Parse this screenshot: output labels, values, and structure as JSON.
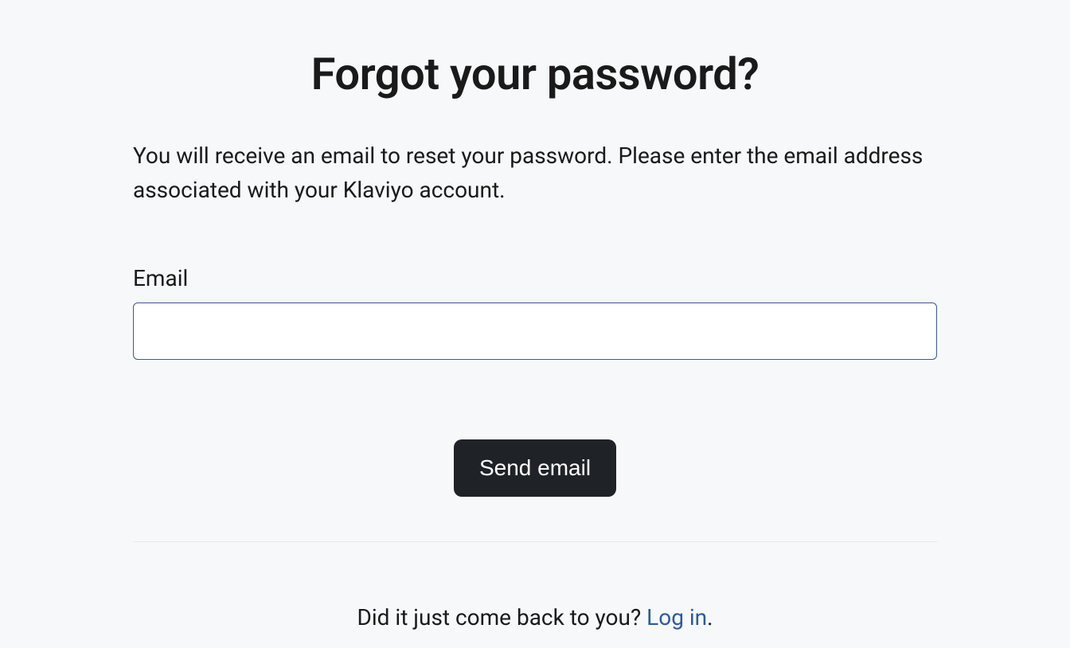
{
  "page": {
    "title": "Forgot your password?",
    "description": "You will receive an email to reset your password. Please enter the email address associated with your Klaviyo account."
  },
  "form": {
    "email_label": "Email",
    "email_value": "",
    "submit_label": "Send email"
  },
  "footer": {
    "prompt": "Did it just come back to you? ",
    "login_link_text": "Log in",
    "suffix": "."
  }
}
